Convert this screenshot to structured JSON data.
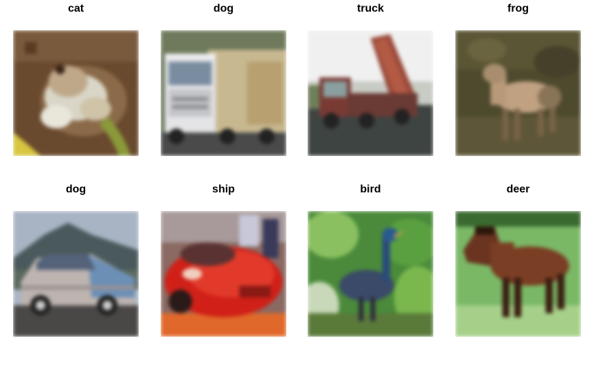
{
  "images": [
    {
      "label": "cat",
      "subject": "frog"
    },
    {
      "label": "dog",
      "subject": "truck"
    },
    {
      "label": "truck",
      "subject": "dump-truck"
    },
    {
      "label": "frog",
      "subject": "deer"
    },
    {
      "label": "dog",
      "subject": "car"
    },
    {
      "label": "ship",
      "subject": "sports-car"
    },
    {
      "label": "bird",
      "subject": "bird"
    },
    {
      "label": "deer",
      "subject": "horse"
    }
  ]
}
